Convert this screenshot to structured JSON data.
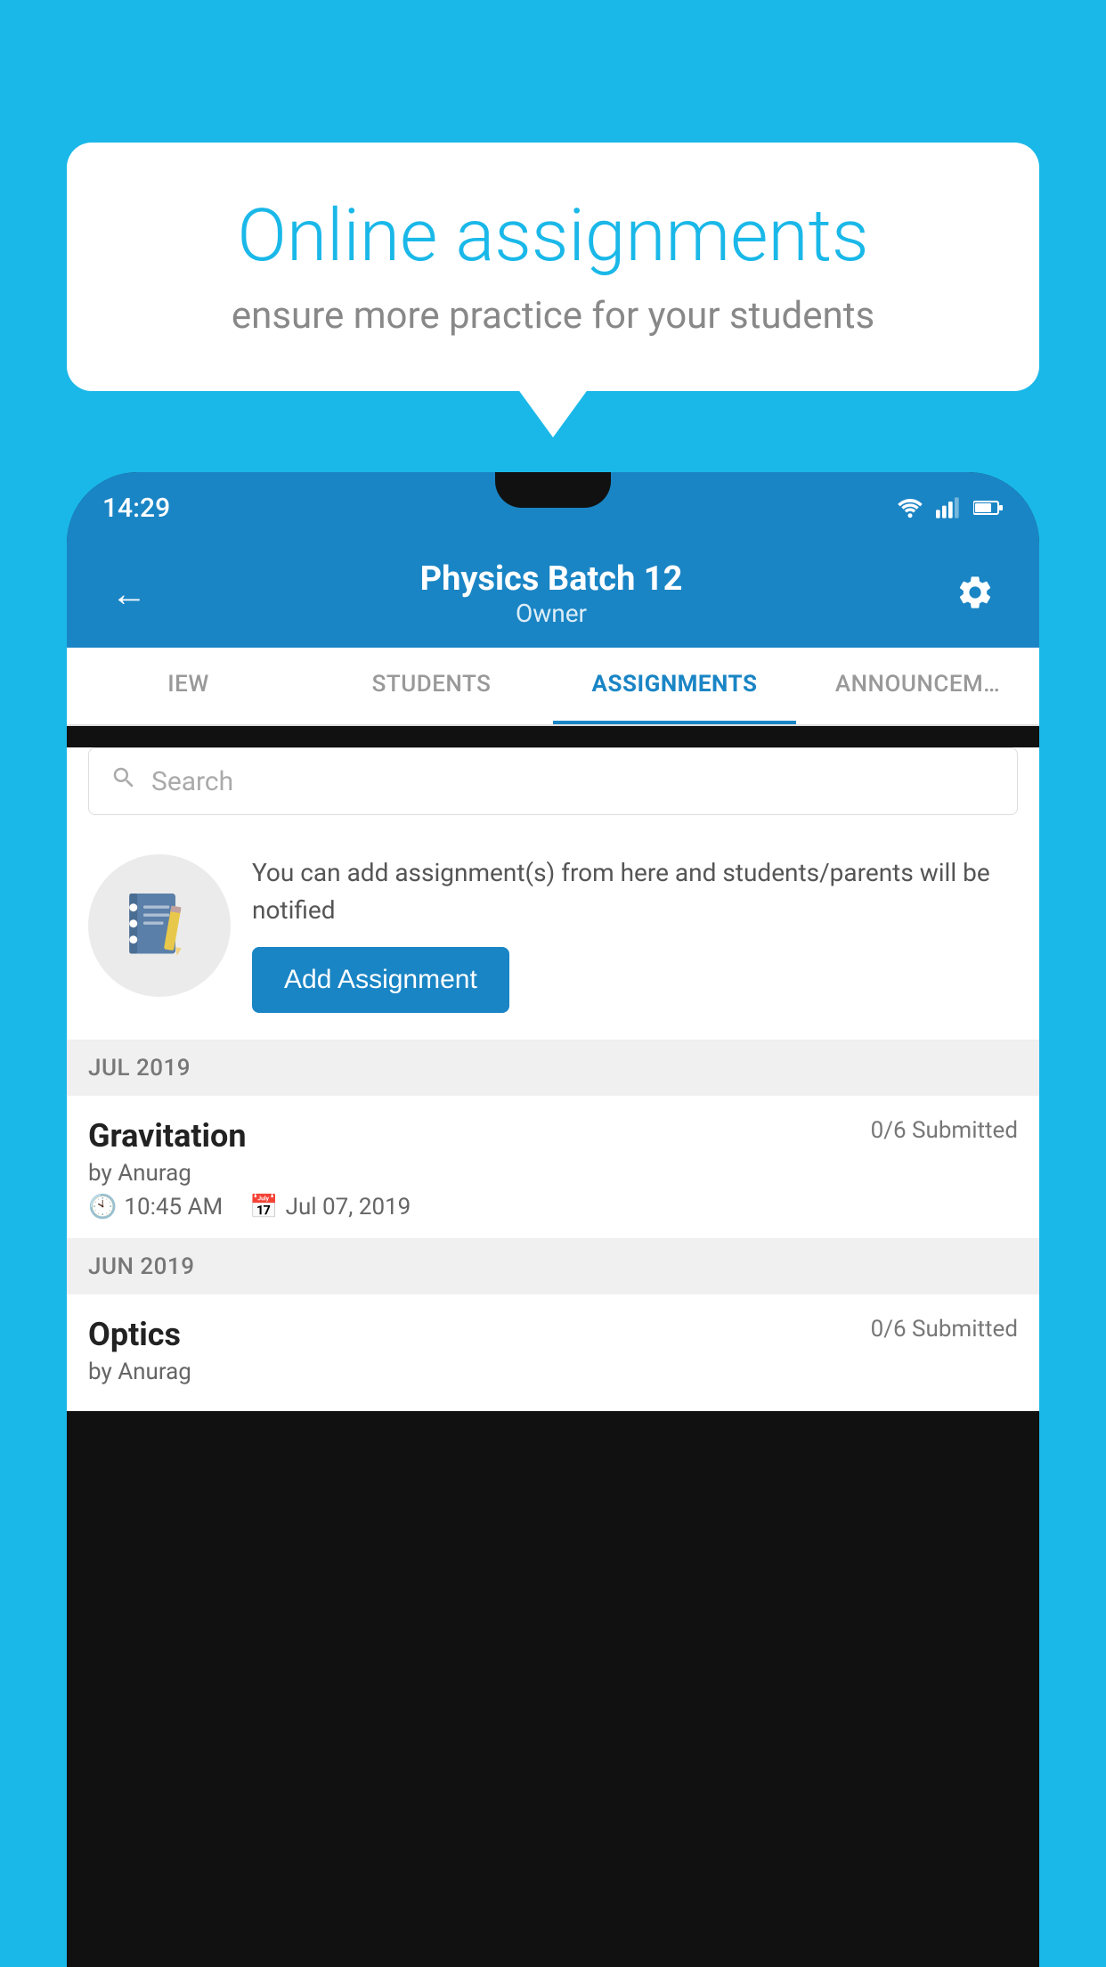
{
  "background_color": "#1ab8e8",
  "speech_bubble": {
    "title": "Online assignments",
    "subtitle": "ensure more practice for your students"
  },
  "phone": {
    "status_bar": {
      "time": "14:29"
    },
    "header": {
      "title": "Physics Batch 12",
      "subtitle": "Owner",
      "back_label": "←",
      "settings_label": "⚙"
    },
    "tabs": [
      {
        "label": "IEW",
        "active": false
      },
      {
        "label": "STUDENTS",
        "active": false
      },
      {
        "label": "ASSIGNMENTS",
        "active": true
      },
      {
        "label": "ANNOUNCEM…",
        "active": false
      }
    ],
    "search": {
      "placeholder": "Search"
    },
    "promo": {
      "description": "You can add assignment(s) from here and students/parents will be notified",
      "add_button_label": "Add Assignment"
    },
    "sections": [
      {
        "header": "JUL 2019",
        "assignments": [
          {
            "name": "Gravitation",
            "submitted": "0/6 Submitted",
            "by": "by Anurag",
            "time": "10:45 AM",
            "date": "Jul 07, 2019"
          }
        ]
      },
      {
        "header": "JUN 2019",
        "assignments": [
          {
            "name": "Optics",
            "submitted": "0/6 Submitted",
            "by": "by Anurag",
            "time": "",
            "date": ""
          }
        ]
      }
    ]
  }
}
